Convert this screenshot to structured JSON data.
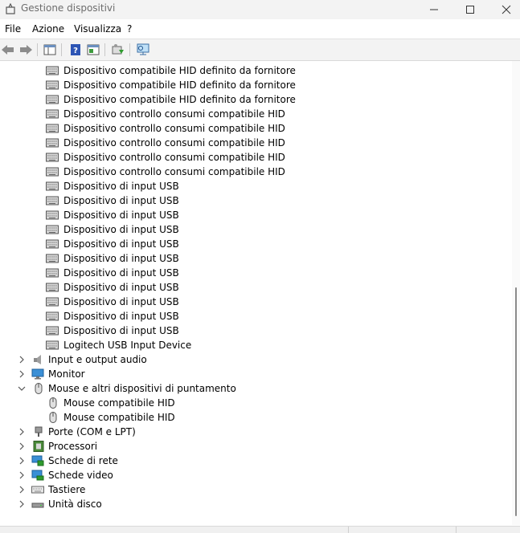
{
  "window": {
    "title": "Gestione dispositivi",
    "controls": [
      "minimize-icon",
      "maximize-icon",
      "close-icon"
    ]
  },
  "menu": [
    "File",
    "Azione",
    "Visualizza",
    "?"
  ],
  "toolbar": {
    "buttons": [
      "back-arrow-icon",
      "forward-arrow-icon",
      "show-hide-console-tree-icon",
      "help-icon",
      "properties-pane-icon",
      "update-driver-icon",
      "scan-hardware-changes-icon"
    ]
  },
  "tree": {
    "hid_children": [
      "Dispositivo compatibile HID definito da fornitore",
      "Dispositivo compatibile HID definito da fornitore",
      "Dispositivo compatibile HID definito da fornitore",
      "Dispositivo controllo consumi compatibile HID",
      "Dispositivo controllo consumi compatibile HID",
      "Dispositivo controllo consumi compatibile HID",
      "Dispositivo controllo consumi compatibile HID",
      "Dispositivo controllo consumi compatibile HID",
      "Dispositivo di input USB",
      "Dispositivo di input USB",
      "Dispositivo di input USB",
      "Dispositivo di input USB",
      "Dispositivo di input USB",
      "Dispositivo di input USB",
      "Dispositivo di input USB",
      "Dispositivo di input USB",
      "Dispositivo di input USB",
      "Dispositivo di input USB",
      "Dispositivo di input USB",
      "Logitech USB Input Device"
    ],
    "categories_before": [
      {
        "label": "Input e output audio",
        "icon": "speaker-icon"
      },
      {
        "label": "Monitor",
        "icon": "monitor-icon"
      }
    ],
    "mouse_category": {
      "label": "Mouse e altri dispositivi di puntamento",
      "icon": "mouse-icon",
      "expanded": true
    },
    "mouse_children": [
      "Mouse compatibile HID",
      "Mouse compatibile HID"
    ],
    "categories_after": [
      {
        "label": "Porte (COM e LPT)",
        "icon": "port-icon"
      },
      {
        "label": "Processori",
        "icon": "processor-icon"
      },
      {
        "label": "Schede di rete",
        "icon": "network-adapter-icon"
      },
      {
        "label": "Schede video",
        "icon": "display-adapter-icon"
      },
      {
        "label": "Tastiere",
        "icon": "keyboard-icon"
      },
      {
        "label": "Unità disco",
        "icon": "disk-drive-icon"
      }
    ]
  }
}
